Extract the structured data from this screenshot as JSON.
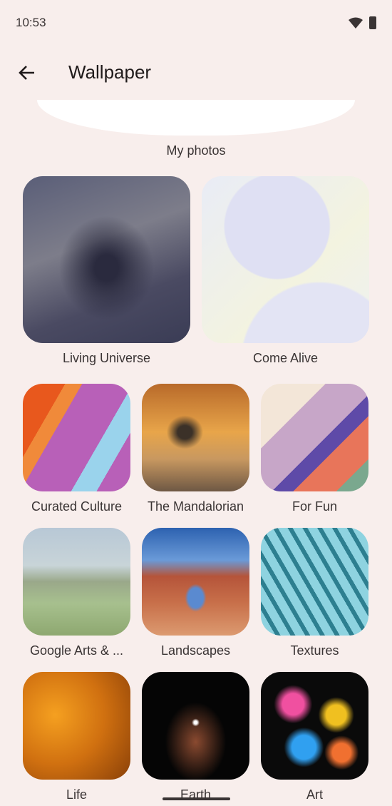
{
  "status_bar": {
    "time": "10:53",
    "wifi_icon": "wifi-icon",
    "battery_icon": "battery-charging-icon"
  },
  "header": {
    "back_icon": "arrow-back-icon",
    "title": "Wallpaper"
  },
  "my_photos": {
    "label": "My photos"
  },
  "categories": [
    {
      "label": "Living Universe"
    },
    {
      "label": "Come Alive"
    },
    {
      "label": "Curated Culture"
    },
    {
      "label": "The Mandalorian"
    },
    {
      "label": "For Fun"
    },
    {
      "label": "Google Arts & ..."
    },
    {
      "label": "Landscapes"
    },
    {
      "label": "Textures"
    },
    {
      "label": "Life"
    },
    {
      "label": "Earth"
    },
    {
      "label": "Art"
    }
  ],
  "colors": {
    "background": "#f8eeec",
    "text": "#1f1a1a"
  }
}
